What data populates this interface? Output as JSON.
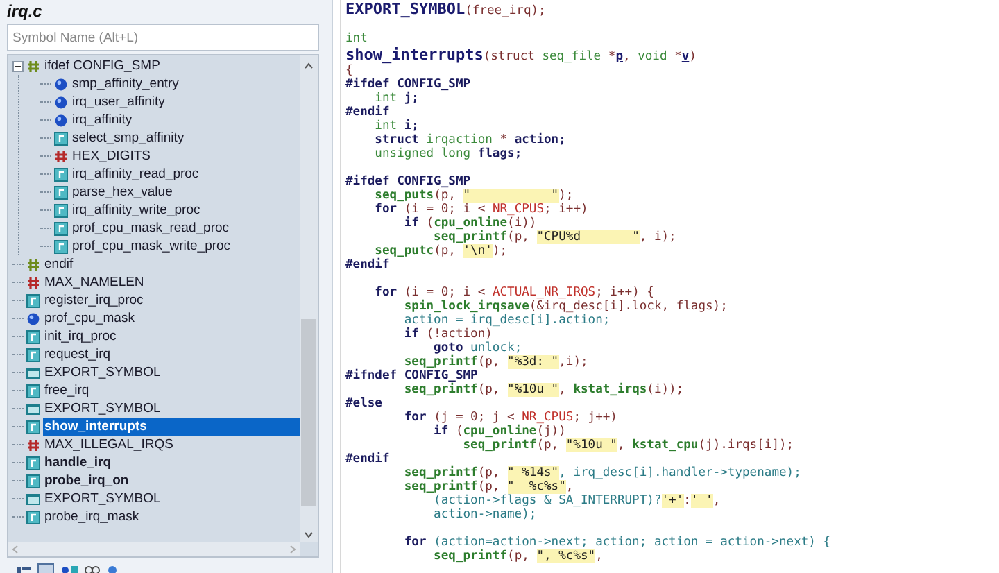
{
  "outline": {
    "title": "irq.c",
    "search": {
      "placeholder": "Symbol Name (Alt+L)"
    },
    "items": [
      {
        "label": "ifdef CONFIG_SMP",
        "kind": "ifdef",
        "selected": false,
        "bold": false,
        "expanded": true,
        "children": [
          {
            "label": "smp_affinity_entry",
            "kind": "variable",
            "selected": false,
            "bold": false
          },
          {
            "label": "irq_user_affinity",
            "kind": "variable",
            "selected": false,
            "bold": false
          },
          {
            "label": "irq_affinity",
            "kind": "variable",
            "selected": false,
            "bold": false
          },
          {
            "label": "select_smp_affinity",
            "kind": "function",
            "selected": false,
            "bold": false
          },
          {
            "label": "HEX_DIGITS",
            "kind": "define",
            "selected": false,
            "bold": false
          },
          {
            "label": "irq_affinity_read_proc",
            "kind": "function",
            "selected": false,
            "bold": false
          },
          {
            "label": "parse_hex_value",
            "kind": "function",
            "selected": false,
            "bold": false
          },
          {
            "label": "irq_affinity_write_proc",
            "kind": "function",
            "selected": false,
            "bold": false
          },
          {
            "label": "prof_cpu_mask_read_proc",
            "kind": "function",
            "selected": false,
            "bold": false
          },
          {
            "label": "prof_cpu_mask_write_proc",
            "kind": "function",
            "selected": false,
            "bold": false
          }
        ]
      },
      {
        "label": "endif",
        "kind": "ifdef",
        "selected": false,
        "bold": false
      },
      {
        "label": "MAX_NAMELEN",
        "kind": "define",
        "selected": false,
        "bold": false
      },
      {
        "label": "register_irq_proc",
        "kind": "function",
        "selected": false,
        "bold": false
      },
      {
        "label": "prof_cpu_mask",
        "kind": "variable",
        "selected": false,
        "bold": false
      },
      {
        "label": "init_irq_proc",
        "kind": "function",
        "selected": false,
        "bold": false
      },
      {
        "label": "request_irq",
        "kind": "function",
        "selected": false,
        "bold": false
      },
      {
        "label": "EXPORT_SYMBOL",
        "kind": "export",
        "selected": false,
        "bold": false
      },
      {
        "label": "free_irq",
        "kind": "function",
        "selected": false,
        "bold": false
      },
      {
        "label": "EXPORT_SYMBOL",
        "kind": "export",
        "selected": false,
        "bold": false
      },
      {
        "label": "show_interrupts",
        "kind": "function",
        "selected": true,
        "bold": false
      },
      {
        "label": "MAX_ILLEGAL_IRQS",
        "kind": "define",
        "selected": false,
        "bold": false
      },
      {
        "label": "handle_irq",
        "kind": "function",
        "selected": false,
        "bold": true
      },
      {
        "label": "probe_irq_on",
        "kind": "function",
        "selected": false,
        "bold": true
      },
      {
        "label": "EXPORT_SYMBOL",
        "kind": "export",
        "selected": false,
        "bold": false
      },
      {
        "label": "probe_irq_mask",
        "kind": "function",
        "selected": false,
        "bold": false
      }
    ]
  },
  "code": {
    "lines": [
      {
        "kind": "code",
        "segments": [
          {
            "kind": "heading",
            "text": "EXPORT_SYMBOL"
          },
          {
            "kind": "punct",
            "text": "(free_irq);"
          }
        ]
      },
      {
        "kind": "blank"
      },
      {
        "kind": "code",
        "segments": [
          {
            "kind": "type",
            "text": "int"
          }
        ]
      },
      {
        "kind": "code",
        "segments": [
          {
            "kind": "heading",
            "text": "show_interrupts"
          },
          {
            "kind": "punct",
            "text": "(struct "
          },
          {
            "kind": "type",
            "text": "seq_file "
          },
          {
            "kind": "punct",
            "text": "*"
          },
          {
            "kind": "param",
            "text": "p"
          },
          {
            "kind": "punct",
            "text": ", "
          },
          {
            "kind": "type",
            "text": "void "
          },
          {
            "kind": "punct",
            "text": "*"
          },
          {
            "kind": "param",
            "text": "v"
          },
          {
            "kind": "punct",
            "text": ")"
          }
        ]
      },
      {
        "kind": "code",
        "segments": [
          {
            "kind": "punct",
            "text": "{"
          }
        ]
      },
      {
        "kind": "code",
        "segments": [
          {
            "kind": "directive",
            "text": "#ifdef CONFIG_SMP"
          }
        ]
      },
      {
        "kind": "code",
        "segments": [
          {
            "kind": "type",
            "text": "    int "
          },
          {
            "kind": "directive",
            "text": "j;"
          }
        ]
      },
      {
        "kind": "code",
        "segments": [
          {
            "kind": "directive",
            "text": "#endif"
          }
        ]
      },
      {
        "kind": "code",
        "segments": [
          {
            "kind": "type",
            "text": "    int "
          },
          {
            "kind": "directive",
            "text": "i;"
          }
        ]
      },
      {
        "kind": "code",
        "segments": [
          {
            "kind": "directive",
            "text": "    struct "
          },
          {
            "kind": "type",
            "text": "irqaction "
          },
          {
            "kind": "punct",
            "text": "* "
          },
          {
            "kind": "directive",
            "text": "action;"
          }
        ]
      },
      {
        "kind": "code",
        "segments": [
          {
            "kind": "type",
            "text": "    unsigned long "
          },
          {
            "kind": "directive",
            "text": "flags;"
          }
        ]
      },
      {
        "kind": "blank"
      },
      {
        "kind": "code",
        "segments": [
          {
            "kind": "directive",
            "text": "#ifdef CONFIG_SMP"
          }
        ]
      },
      {
        "kind": "code",
        "segments": [
          {
            "kind": "call",
            "text": "    seq_puts"
          },
          {
            "kind": "punct",
            "text": "(p, "
          },
          {
            "kind": "string",
            "text": "\"           \""
          },
          {
            "kind": "punct",
            "text": ");"
          }
        ]
      },
      {
        "kind": "code",
        "segments": [
          {
            "kind": "directive",
            "text": "    for "
          },
          {
            "kind": "punct",
            "text": "(i = 0; i < "
          },
          {
            "kind": "macro",
            "text": "NR_CPUS"
          },
          {
            "kind": "punct",
            "text": "; i++)"
          }
        ]
      },
      {
        "kind": "code",
        "segments": [
          {
            "kind": "directive",
            "text": "        if "
          },
          {
            "kind": "punct",
            "text": "("
          },
          {
            "kind": "call",
            "text": "cpu_online"
          },
          {
            "kind": "punct",
            "text": "(i))"
          }
        ]
      },
      {
        "kind": "code",
        "segments": [
          {
            "kind": "call",
            "text": "            seq_printf"
          },
          {
            "kind": "punct",
            "text": "(p, "
          },
          {
            "kind": "string",
            "text": "\"CPU%d       \""
          },
          {
            "kind": "punct",
            "text": ", i);"
          }
        ]
      },
      {
        "kind": "code",
        "segments": [
          {
            "kind": "call",
            "text": "    seq_putc"
          },
          {
            "kind": "punct",
            "text": "(p, "
          },
          {
            "kind": "string",
            "text": "'\\n'"
          },
          {
            "kind": "punct",
            "text": ");"
          }
        ]
      },
      {
        "kind": "code",
        "segments": [
          {
            "kind": "directive",
            "text": "#endif"
          }
        ]
      },
      {
        "kind": "blank"
      },
      {
        "kind": "code",
        "segments": [
          {
            "kind": "directive",
            "text": "    for "
          },
          {
            "kind": "punct",
            "text": "(i = 0; i < "
          },
          {
            "kind": "macro",
            "text": "ACTUAL_NR_IRQS"
          },
          {
            "kind": "punct",
            "text": "; i++) {"
          }
        ]
      },
      {
        "kind": "code",
        "segments": [
          {
            "kind": "call",
            "text": "        spin_lock_irqsave"
          },
          {
            "kind": "punct",
            "text": "(&irq_desc[i].lock, flags);"
          }
        ]
      },
      {
        "kind": "code",
        "segments": [
          {
            "kind": "variable",
            "text": "        action = irq_desc[i].action;"
          }
        ]
      },
      {
        "kind": "code",
        "segments": [
          {
            "kind": "directive",
            "text": "        if "
          },
          {
            "kind": "punct",
            "text": "(!action)"
          }
        ]
      },
      {
        "kind": "code",
        "segments": [
          {
            "kind": "directive",
            "text": "            goto "
          },
          {
            "kind": "variable",
            "text": "unlock;"
          }
        ]
      },
      {
        "kind": "code",
        "segments": [
          {
            "kind": "call",
            "text": "        seq_printf"
          },
          {
            "kind": "punct",
            "text": "(p, "
          },
          {
            "kind": "string",
            "text": "\"%3d: \""
          },
          {
            "kind": "punct",
            "text": ",i);"
          }
        ]
      },
      {
        "kind": "code",
        "segments": [
          {
            "kind": "directive",
            "text": "#ifndef CONFIG_SMP"
          }
        ]
      },
      {
        "kind": "code",
        "segments": [
          {
            "kind": "call",
            "text": "        seq_printf"
          },
          {
            "kind": "punct",
            "text": "(p, "
          },
          {
            "kind": "string",
            "text": "\"%10u \""
          },
          {
            "kind": "punct",
            "text": ", "
          },
          {
            "kind": "call",
            "text": "kstat_irqs"
          },
          {
            "kind": "punct",
            "text": "(i));"
          }
        ]
      },
      {
        "kind": "code",
        "segments": [
          {
            "kind": "directive",
            "text": "#else"
          }
        ]
      },
      {
        "kind": "code",
        "segments": [
          {
            "kind": "directive",
            "text": "        for "
          },
          {
            "kind": "punct",
            "text": "(j = 0; j < "
          },
          {
            "kind": "macro",
            "text": "NR_CPUS"
          },
          {
            "kind": "punct",
            "text": "; j++)"
          }
        ]
      },
      {
        "kind": "code",
        "segments": [
          {
            "kind": "directive",
            "text": "            if "
          },
          {
            "kind": "punct",
            "text": "("
          },
          {
            "kind": "call",
            "text": "cpu_online"
          },
          {
            "kind": "punct",
            "text": "(j))"
          }
        ]
      },
      {
        "kind": "code",
        "segments": [
          {
            "kind": "call",
            "text": "                seq_printf"
          },
          {
            "kind": "punct",
            "text": "(p, "
          },
          {
            "kind": "string",
            "text": "\"%10u \""
          },
          {
            "kind": "punct",
            "text": ", "
          },
          {
            "kind": "call",
            "text": "kstat_cpu"
          },
          {
            "kind": "punct",
            "text": "(j).irqs[i]);"
          }
        ]
      },
      {
        "kind": "code",
        "segments": [
          {
            "kind": "directive",
            "text": "#endif"
          }
        ]
      },
      {
        "kind": "code",
        "segments": [
          {
            "kind": "call",
            "text": "        seq_printf"
          },
          {
            "kind": "punct",
            "text": "(p, "
          },
          {
            "kind": "string",
            "text": "\" %14s\""
          },
          {
            "kind": "variable",
            "text": ", irq_desc[i].handler->typename);"
          }
        ]
      },
      {
        "kind": "code",
        "segments": [
          {
            "kind": "call",
            "text": "        seq_printf"
          },
          {
            "kind": "punct",
            "text": "(p, "
          },
          {
            "kind": "string",
            "text": "\"  %c%s\""
          },
          {
            "kind": "punct",
            "text": ","
          }
        ]
      },
      {
        "kind": "code",
        "segments": [
          {
            "kind": "variable",
            "text": "            (action->flags & SA_INTERRUPT)?"
          },
          {
            "kind": "string",
            "text": "'+'"
          },
          {
            "kind": "punct",
            "text": ":"
          },
          {
            "kind": "string",
            "text": "' '"
          },
          {
            "kind": "punct",
            "text": ","
          }
        ]
      },
      {
        "kind": "code",
        "segments": [
          {
            "kind": "variable",
            "text": "            action->name);"
          }
        ]
      },
      {
        "kind": "blank"
      },
      {
        "kind": "code",
        "segments": [
          {
            "kind": "directive",
            "text": "        for "
          },
          {
            "kind": "variable",
            "text": "(action=action->next; action; action = action->next) {"
          }
        ]
      },
      {
        "kind": "code",
        "segments": [
          {
            "kind": "call",
            "text": "            seq_printf"
          },
          {
            "kind": "punct",
            "text": "(p, "
          },
          {
            "kind": "string",
            "text": "\", %c%s\""
          },
          {
            "kind": "punct",
            "text": ","
          }
        ]
      }
    ]
  }
}
